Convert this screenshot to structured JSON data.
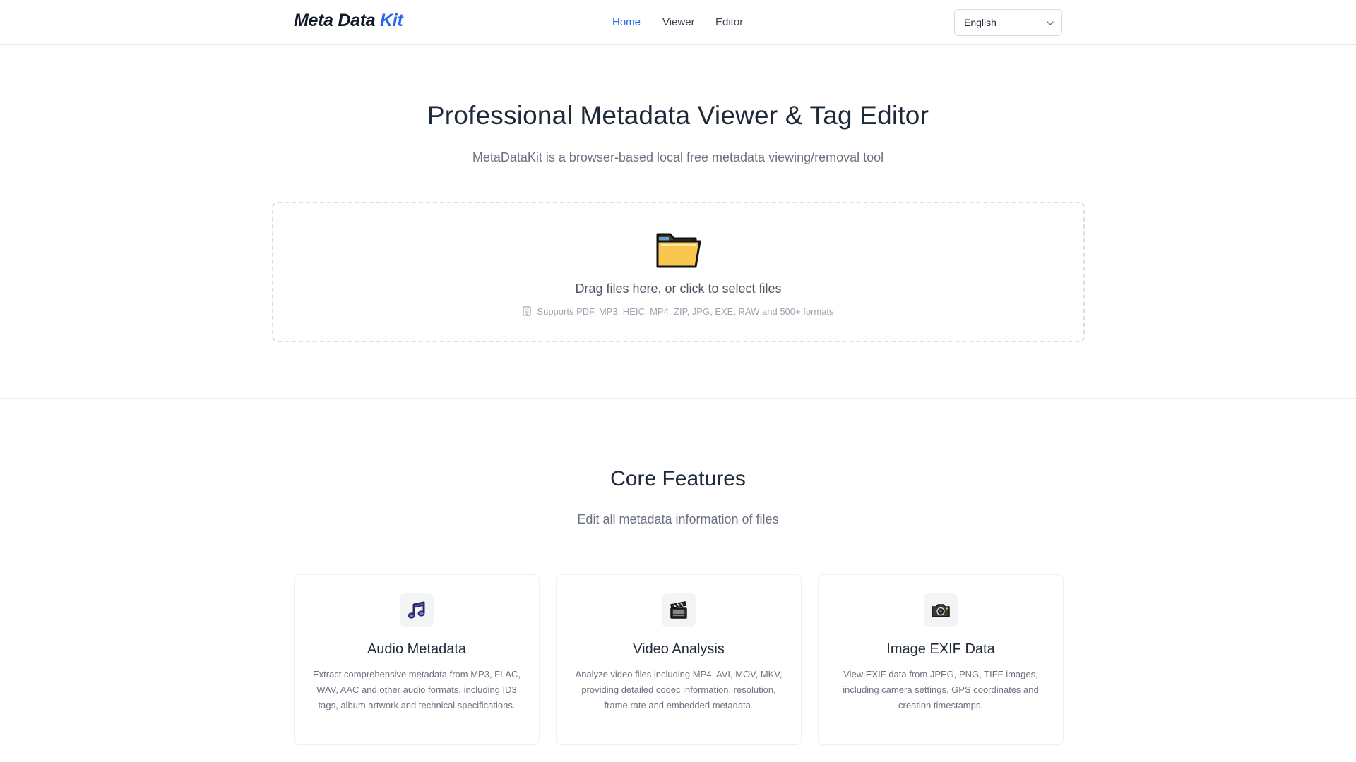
{
  "header": {
    "logo_main": "Meta Data ",
    "logo_accent": "Kit",
    "nav": [
      {
        "label": "Home",
        "active": true
      },
      {
        "label": "Viewer",
        "active": false
      },
      {
        "label": "Editor",
        "active": false
      }
    ],
    "language": "English"
  },
  "hero": {
    "title": "Professional Metadata Viewer & Tag Editor",
    "subtitle": "MetaDataKit is a browser-based local free metadata viewing/removal tool",
    "drop_text": "Drag files here, or click to select files",
    "formats": "Supports PDF, MP3, HEIC, MP4, ZIP, JPG, EXE, RAW and 500+ formats"
  },
  "features": {
    "title": "Core Features",
    "subtitle": "Edit all metadata information of files",
    "cards": [
      {
        "icon": "music-note-icon",
        "title": "Audio Metadata",
        "description": "Extract comprehensive metadata from MP3, FLAC, WAV, AAC and other audio formats, including ID3 tags, album artwork and technical specifications."
      },
      {
        "icon": "clapperboard-icon",
        "title": "Video Analysis",
        "description": "Analyze video files including MP4, AVI, MOV, MKV, providing detailed codec information, resolution, frame rate and embedded metadata."
      },
      {
        "icon": "camera-icon",
        "title": "Image EXIF Data",
        "description": "View EXIF data from JPEG, PNG, TIFF images, including camera settings, GPS coordinates and creation timestamps."
      }
    ]
  },
  "colors": {
    "accent": "#2563eb",
    "text": "#1f2937",
    "muted": "#6b7280"
  }
}
